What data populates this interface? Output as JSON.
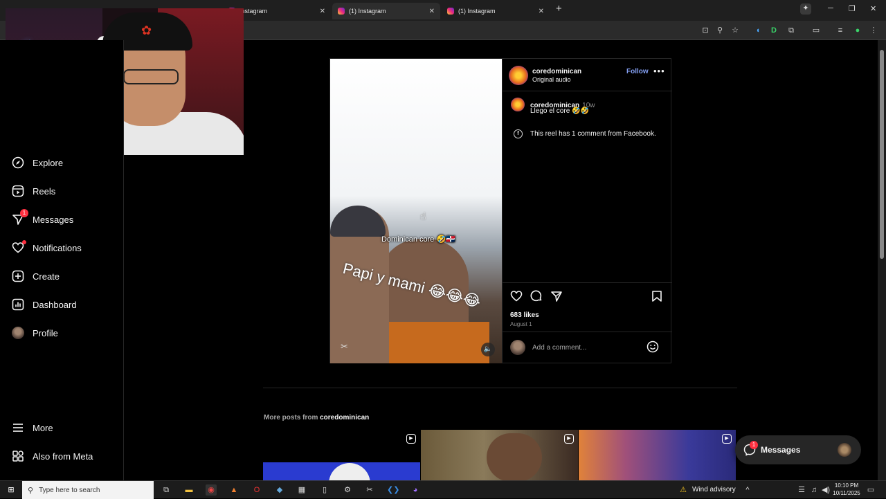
{
  "browser": {
    "tabs": [
      {
        "label": "Instagram"
      },
      {
        "label": "(1) Instagram"
      },
      {
        "label": "(1) Instagram"
      }
    ],
    "new_tab_symbol": "+"
  },
  "sidebar": {
    "items": [
      {
        "label": "Explore",
        "icon": "compass-icon"
      },
      {
        "label": "Reels",
        "icon": "reels-icon"
      },
      {
        "label": "Messages",
        "icon": "messenger-icon",
        "badge": "1"
      },
      {
        "label": "Notifications",
        "icon": "heart-icon"
      },
      {
        "label": "Create",
        "icon": "plus-square-icon"
      },
      {
        "label": "Dashboard",
        "icon": "dashboard-icon"
      },
      {
        "label": "Profile",
        "icon": "avatar"
      }
    ],
    "bottom": [
      {
        "label": "More",
        "icon": "hamburger-icon"
      },
      {
        "label": "Also from Meta",
        "icon": "meta-grid-icon"
      }
    ]
  },
  "post": {
    "username": "coredominican",
    "audio": "Original audio",
    "follow_label": "Follow",
    "caption_user": "coredominican",
    "caption_time": "10w",
    "caption_text": "Llego el core 🤣🤣",
    "facebook_note": "This reel has 1 comment from Facebook.",
    "likes": "683 likes",
    "date": "August 1",
    "comment_placeholder": "Add a comment...",
    "overlay_text_1": "Dominican core 🤣🇩🇴",
    "overlay_text_2": "Papi y mami 😂😂😂"
  },
  "more_posts": {
    "prefix": "More posts from",
    "user": "coredominican"
  },
  "messages_pill": {
    "label": "Messages",
    "badge": "1"
  },
  "taskbar": {
    "search_placeholder": "Type here to search",
    "weather": "Wind advisory",
    "time": "10:10 PM",
    "date": "10/11/2025"
  },
  "colors": {
    "link_blue": "#85a1f5",
    "badge_red": "#ff3040",
    "background": "#000000"
  }
}
